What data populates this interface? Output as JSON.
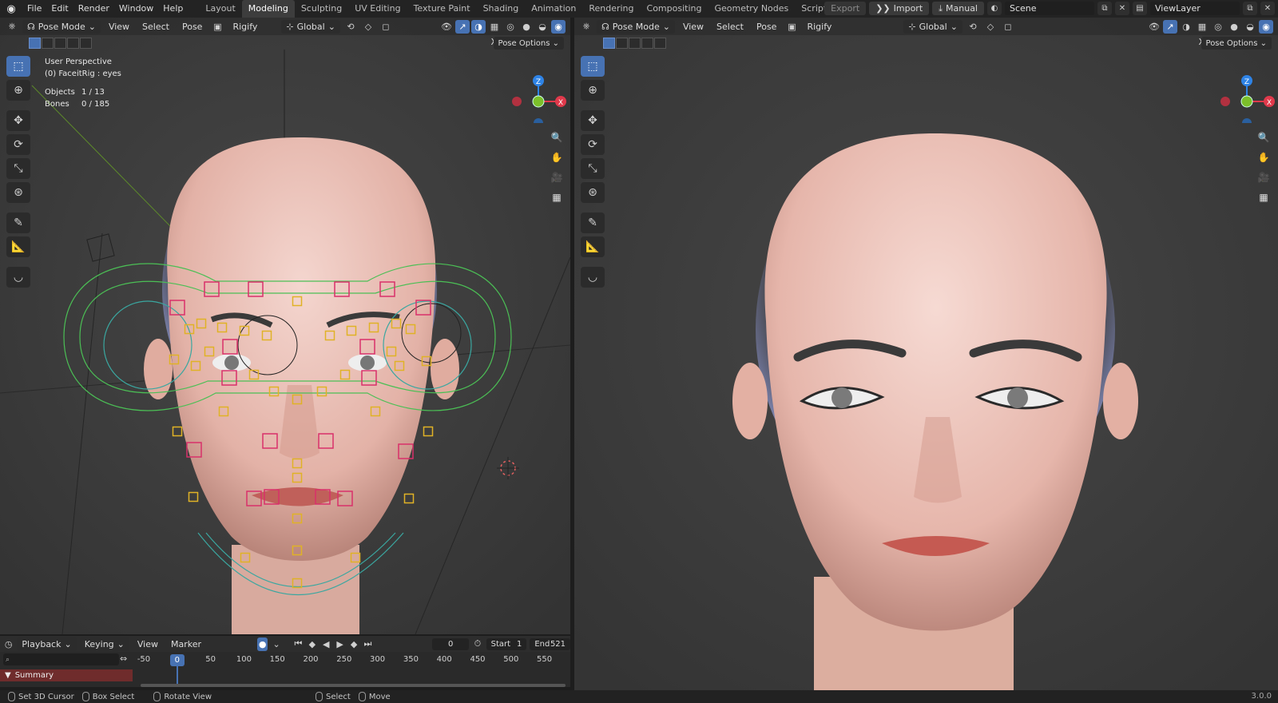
{
  "topbar": {
    "menus": [
      "File",
      "Edit",
      "Render",
      "Window",
      "Help"
    ],
    "workspaces": [
      "Layout",
      "Modeling",
      "Sculpting",
      "UV Editing",
      "Texture Paint",
      "Shading",
      "Animation",
      "Rendering",
      "Compositing",
      "Geometry Nodes",
      "Scripting"
    ],
    "active_workspace": "Modeling",
    "export_label": "Export",
    "import_label": "Import",
    "manual_label": "Manual",
    "scene": "Scene",
    "view_layer": "ViewLayer"
  },
  "left_viewport": {
    "mode": "Pose Mode",
    "menus": [
      "View",
      "Select",
      "Pose"
    ],
    "rigify": "Rigify",
    "transform_orientation": "Global",
    "pose_options": "Pose Options",
    "x_label": "X",
    "overlay": {
      "perspective": "User Perspective",
      "active": "(0) FaceitRig : eyes",
      "objects_label": "Objects",
      "objects_value": "1 / 13",
      "bones_label": "Bones",
      "bones_value": "0 / 185"
    }
  },
  "right_viewport": {
    "mode": "Pose Mode",
    "menus": [
      "View",
      "Select",
      "Pose"
    ],
    "rigify": "Rigify",
    "transform_orientation": "Global",
    "pose_options": "Pose Options",
    "x_label": "X"
  },
  "gizmo": {
    "z": "Z",
    "x": "X",
    "colors": {
      "x": "#e0394b",
      "y": "#7cbf2a",
      "z": "#2e83e6"
    }
  },
  "timeline": {
    "playback": "Playback",
    "keying": "Keying",
    "view": "View",
    "marker": "Marker",
    "current_frame": "0",
    "start_label": "Start",
    "start_value": "1",
    "end_label": "End",
    "end_value": "521",
    "ruler_labels": [
      "-50",
      "0",
      "50",
      "100",
      "150",
      "200",
      "250",
      "300",
      "350",
      "400",
      "450",
      "500",
      "550"
    ],
    "summary": "Summary"
  },
  "statusbar": {
    "items": [
      "Set 3D Cursor",
      "Box Select",
      "Rotate View",
      "Select",
      "Move"
    ],
    "version": "3.0.0"
  },
  "colors": {
    "accent": "#4772b3",
    "summary": "#6f2c2c"
  }
}
